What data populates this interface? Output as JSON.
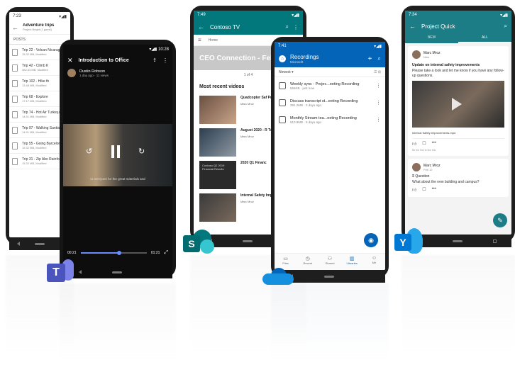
{
  "teams_list": {
    "status_time": "7:23",
    "title": "Adventure trips",
    "subtitle": "Project Bright (1 guest)",
    "tab": "POSTS",
    "files": [
      {
        "name": "Trip 22 - Volcan Nicaragua.mp4",
        "meta": "15.32 MB, Modified"
      },
      {
        "name": "Trip 42 - Climb K",
        "meta": "382.63 MB, Modified"
      },
      {
        "name": "Trip 102 - Hike th",
        "meta": "13.48 MB, Modified"
      },
      {
        "name": "Trip 68 - Explore",
        "meta": "17.17 MB, Modified"
      },
      {
        "name": "Trip 74 - Hot Air Turkey.mp4",
        "meta": "14.51 MB, Modified"
      },
      {
        "name": "Trip 97 - Walking Santiago.mp4",
        "meta": "14.51 MB, Modified"
      },
      {
        "name": "Trip 55 - Going Barcelona.mp4",
        "meta": "15.32 MB, Modified"
      },
      {
        "name": "Trip 31 - Zip Abo Rainforests.mp4",
        "meta": "15.32 MB, Modified"
      }
    ]
  },
  "video": {
    "status_time": "10:28",
    "title": "Introduction to Office",
    "author": "Dustin Robson",
    "meta": "1 day ago · 11 views",
    "caption": "to everyone for the great materials and",
    "elapsed": "00:21",
    "remaining": "01:21",
    "progress": 0.58
  },
  "sharepoint": {
    "status_time": "7:49",
    "title": "Contoso TV",
    "breadcrumb": "Home",
    "banner": "CEO Connection - Feb 2",
    "pager": "1 of 4",
    "section": "Most recent videos",
    "videos": [
      {
        "title": "Quadcopter Saf Program Overvi",
        "author": "Marc Mroz"
      },
      {
        "title": "August 2020 - R Town Hall.m4v",
        "author": "Marc Mroz"
      },
      {
        "title": "2020 Q1 Financ",
        "author": ""
      },
      {
        "title": "Internal Safety Improvements.",
        "author": "Marc Mroz"
      }
    ],
    "thumb_text": "Contoso Q2 2019 Financial Results"
  },
  "onedrive": {
    "status_time": "7:41",
    "title": "Recordings",
    "subtitle": "Microsoft",
    "sort": "Newest",
    "files": [
      {
        "name": "Weekly sync - Projec...eeting Recording",
        "meta": "556KB · just now"
      },
      {
        "name": "Discuss transcript st...eeting Recording",
        "meta": "391.2MB · 2 days ago"
      },
      {
        "name": "Monthly Stream tea...eeting Recording",
        "meta": "510.8MB · 5 days ago"
      }
    ],
    "tabs": [
      "Files",
      "Recent",
      "Shared",
      "Libraries",
      "Me"
    ]
  },
  "yammer": {
    "status_time": "7:34",
    "title": "Project Quick",
    "tabs": [
      "NEW",
      "ALL"
    ],
    "post1": {
      "author": "Marc Mroz",
      "time": "Now",
      "headline": "Update on internal safety improvements",
      "body": "Please take a look and let me know if you have any follow-up questions.",
      "file": "Internal Safety Improvements.mp4",
      "likes": "Be the first to like this"
    },
    "post2": {
      "author": "Marc Mroz",
      "time": "Feb 12",
      "tag": "Question",
      "body": "What about the new building and campus?"
    }
  },
  "logos": {
    "teams": "T",
    "sharepoint": "S",
    "yammer": "Y"
  },
  "colors": {
    "teams": "#5b5fc7",
    "sharepoint": "#038387",
    "onedrive": "#0364b8",
    "yammer": "#106ebe"
  }
}
